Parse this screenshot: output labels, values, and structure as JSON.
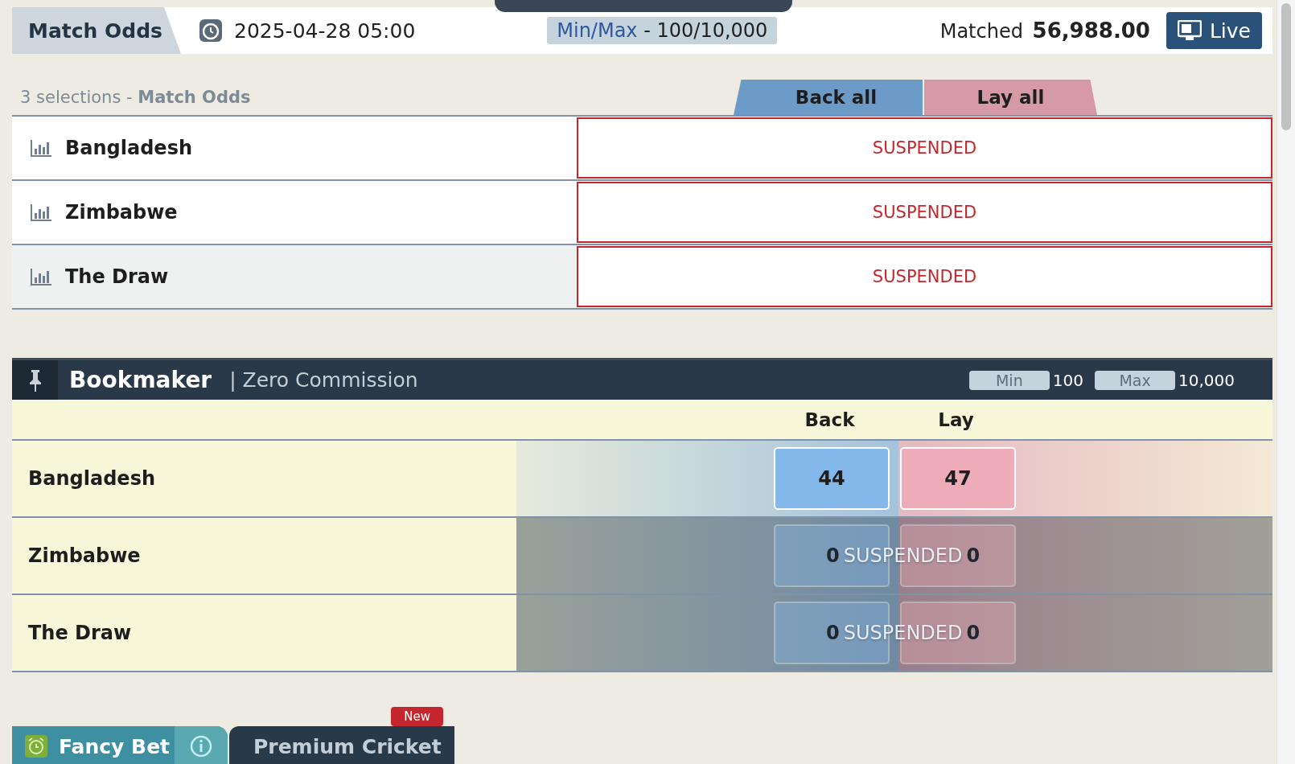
{
  "match_odds": {
    "tab": "Match Odds",
    "start_time": "2025-04-28 05:00",
    "minmax_label": "Min/Max",
    "minmax_value": "- 100/10,000",
    "matched_label": "Matched",
    "matched_value": "56,988.00",
    "live_button": "Live"
  },
  "selections": {
    "count_text": "3 selections",
    "separator": "-",
    "market": "Match Odds",
    "back_all": "Back all",
    "lay_all": "Lay all"
  },
  "runners": [
    {
      "name": "Bangladesh",
      "status": "SUSPENDED",
      "highlighted": false
    },
    {
      "name": "Zimbabwe",
      "status": "SUSPENDED",
      "highlighted": false
    },
    {
      "name": "The Draw",
      "status": "SUSPENDED",
      "highlighted": true
    }
  ],
  "bookmaker": {
    "title": "Bookmaker",
    "subtitle": "| Zero Commission",
    "min_label": "Min",
    "min_value": "100",
    "max_label": "Max",
    "max_value": "10,000",
    "back_header": "Back",
    "lay_header": "Lay",
    "runners": [
      {
        "name": "Bangladesh",
        "back": "44",
        "lay": "47",
        "suspended": false
      },
      {
        "name": "Zimbabwe",
        "back": "0",
        "lay": "0",
        "suspended": true,
        "status": "SUSPENDED"
      },
      {
        "name": "The Draw",
        "back": "0",
        "lay": "0",
        "suspended": true,
        "status": "SUSPENDED"
      }
    ]
  },
  "tabs": [
    {
      "label": "Fancy Bet",
      "kind": "fancy",
      "selected": true
    },
    {
      "label": "Premium Cricket",
      "kind": "premium",
      "selected": false,
      "badge": "New"
    }
  ]
}
